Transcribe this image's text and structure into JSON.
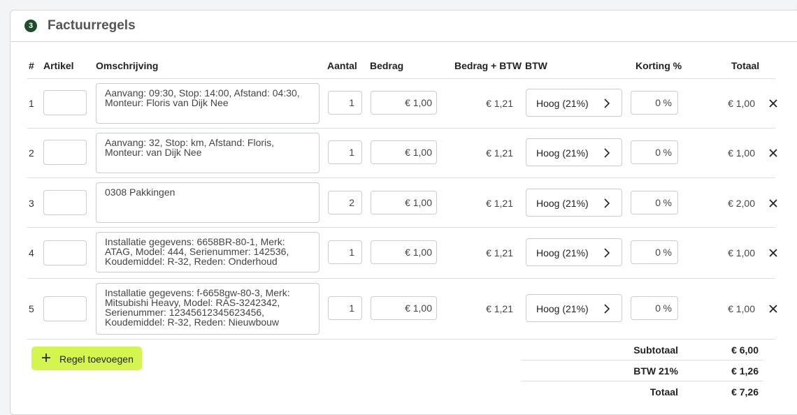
{
  "section": {
    "step": "3",
    "title": "Factuurregels"
  },
  "columns": {
    "num": "#",
    "artikel": "Artikel",
    "omschrijving": "Omschrijving",
    "aantal": "Aantal",
    "bedrag": "Bedrag",
    "bedrag_btw": "Bedrag + BTW",
    "btw": "BTW",
    "korting": "Korting %",
    "totaal": "Totaal"
  },
  "rows": [
    {
      "num": "1",
      "artikel": "",
      "description": "Aanvang: 09:30, Stop: 14:00, Afstand: 04:30, Monteur: Floris van Dijk Nee",
      "qty": "1",
      "amount": "€ 1,00",
      "amount_vat": "€ 1,21",
      "vat": "Hoog (21%)",
      "discount": "0",
      "discount_unit": "%",
      "total": "€ 1,00"
    },
    {
      "num": "2",
      "artikel": "",
      "description": "Aanvang: 32, Stop: km, Afstand: Floris, Monteur: van Dijk Nee",
      "qty": "1",
      "amount": "€ 1,00",
      "amount_vat": "€ 1,21",
      "vat": "Hoog (21%)",
      "discount": "0",
      "discount_unit": "%",
      "total": "€ 1,00"
    },
    {
      "num": "3",
      "artikel": "",
      "description": "0308 Pakkingen",
      "qty": "2",
      "amount": "€ 1,00",
      "amount_vat": "€ 1,21",
      "vat": "Hoog (21%)",
      "discount": "0",
      "discount_unit": "%",
      "total": "€ 2,00"
    },
    {
      "num": "4",
      "artikel": "",
      "description": "Installatie gegevens: 6658BR-80-1, Merk: ATAG, Model: 444, Serienummer: 142536, Koudemiddel: R-32, Reden: Onderhoud",
      "qty": "1",
      "amount": "€ 1,00",
      "amount_vat": "€ 1,21",
      "vat": "Hoog (21%)",
      "discount": "0",
      "discount_unit": "%",
      "total": "€ 1,00"
    },
    {
      "num": "5",
      "artikel": "",
      "description": "Installatie gegevens: f-6658gw-80-3, Merk: Mitsubishi Heavy, Model: RAS-3242342, Serienummer: 12345612345623456, Koudemiddel: R-32, Reden: Nieuwbouw",
      "qty": "1",
      "amount": "€ 1,00",
      "amount_vat": "€ 1,21",
      "vat": "Hoog (21%)",
      "discount": "0",
      "discount_unit": "%",
      "total": "€ 1,00"
    }
  ],
  "add_button": {
    "label": "Regel toevoegen",
    "icon": "plus-icon"
  },
  "summary": {
    "subtotal_label": "Subtotaal",
    "subtotal": "€ 6,00",
    "vat_label": "BTW 21%",
    "vat": "€ 1,26",
    "total_label": "Totaal",
    "total": "€ 7,26"
  },
  "colors": {
    "accent_button": "#d4f54d",
    "step_badge": "#1e4d2b"
  }
}
